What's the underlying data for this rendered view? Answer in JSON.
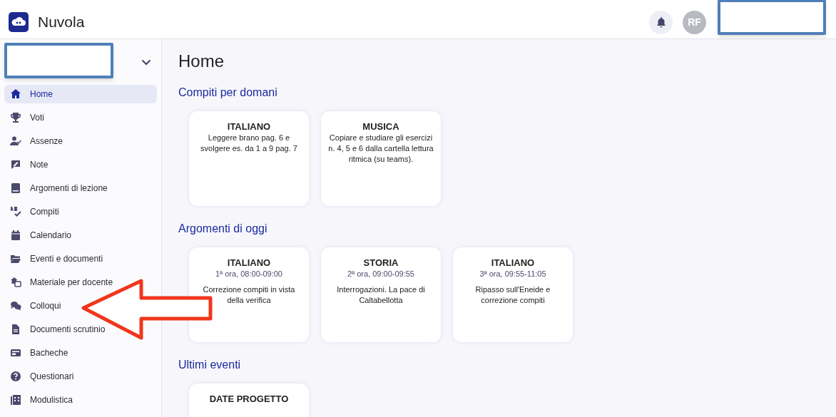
{
  "header": {
    "app_name": "Nuvola",
    "avatar_initials": "RF"
  },
  "sidebar": {
    "items": [
      {
        "label": "Home",
        "selected": true
      },
      {
        "label": "Voti",
        "selected": false
      },
      {
        "label": "Assenze",
        "selected": false
      },
      {
        "label": "Note",
        "selected": false
      },
      {
        "label": "Argomenti di lezione",
        "selected": false
      },
      {
        "label": "Compiti",
        "selected": false
      },
      {
        "label": "Calendario",
        "selected": false
      },
      {
        "label": "Eventi e documenti",
        "selected": false
      },
      {
        "label": "Materiale per docente",
        "selected": false
      },
      {
        "label": "Colloqui",
        "selected": false
      },
      {
        "label": "Documenti scrutinio",
        "selected": false
      },
      {
        "label": "Bacheche",
        "selected": false
      },
      {
        "label": "Questionari",
        "selected": false
      },
      {
        "label": "Modulistica",
        "selected": false
      }
    ]
  },
  "page_title": "Home",
  "sections": [
    {
      "title": "Compiti per domani",
      "cards": [
        {
          "subject": "ITALIANO",
          "text": "Leggere brano pag. 6 e svolgere es. da 1 a 9 pag. 7"
        },
        {
          "subject": "MUSICA",
          "text": "Copiare e studiare gli esercizi n. 4, 5 e 6 dalla cartella lettura ritmica (su teams)."
        }
      ]
    },
    {
      "title": "Argomenti di oggi",
      "cards": [
        {
          "subject": "ITALIANO",
          "time": "1ª ora, 08:00-09:00",
          "text": "Correzione compiti in vista della verifica"
        },
        {
          "subject": "STORIA",
          "time": "2ª ora, 09:00-09:55",
          "text": "Interrogazioni. La pace di Caltabellotta"
        },
        {
          "subject": "ITALIANO",
          "time": "3ª ora, 09:55-11:05",
          "text": "Ripasso sull'Eneide e correzione compiti"
        }
      ]
    },
    {
      "title": "Ultimi eventi",
      "cards": [
        {
          "subject": "DATE PROGETTO"
        }
      ]
    }
  ]
}
